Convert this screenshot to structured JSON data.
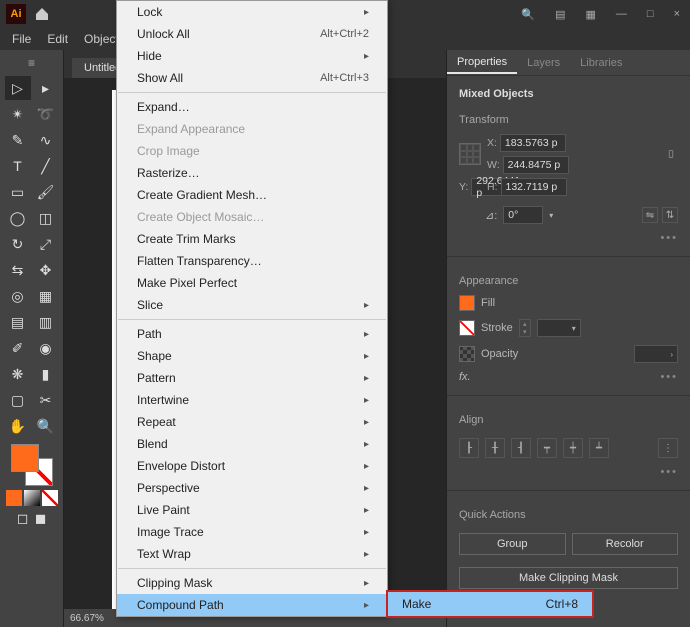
{
  "titlebar": {
    "search_icon": "🔍",
    "layout1": "▤",
    "layout2": "▦",
    "min": "—",
    "max": "□",
    "close": "×"
  },
  "menubar": {
    "file": "File",
    "edit": "Edit",
    "object": "Object"
  },
  "doc": {
    "tab": "Untitled",
    "zoom": "66.67%"
  },
  "menu": {
    "lock": "Lock",
    "unlock_all": "Unlock All",
    "unlock_all_sc": "Alt+Ctrl+2",
    "hide": "Hide",
    "show_all": "Show All",
    "show_all_sc": "Alt+Ctrl+3",
    "expand": "Expand…",
    "expand_appearance": "Expand Appearance",
    "crop_image": "Crop Image",
    "rasterize": "Rasterize…",
    "create_gradient_mesh": "Create Gradient Mesh…",
    "create_object_mosaic": "Create Object Mosaic…",
    "create_trim_marks": "Create Trim Marks",
    "flatten_transparency": "Flatten Transparency…",
    "make_pixel_perfect": "Make Pixel Perfect",
    "slice": "Slice",
    "path": "Path",
    "shape": "Shape",
    "pattern": "Pattern",
    "intertwine": "Intertwine",
    "repeat": "Repeat",
    "blend": "Blend",
    "envelope_distort": "Envelope Distort",
    "perspective": "Perspective",
    "live_paint": "Live Paint",
    "image_trace": "Image Trace",
    "text_wrap": "Text Wrap",
    "clipping_mask": "Clipping Mask",
    "compound_path": "Compound Path"
  },
  "submenu": {
    "make": "Make",
    "make_sc": "Ctrl+8"
  },
  "panel": {
    "tabs": {
      "properties": "Properties",
      "layers": "Layers",
      "libraries": "Libraries"
    },
    "selection": "Mixed Objects",
    "transform": {
      "title": "Transform",
      "x_label": "X:",
      "x_val": "183.5763 p",
      "y_label": "Y:",
      "y_val": "292.6441 p",
      "w_label": "W:",
      "w_val": "244.8475 p",
      "h_label": "H:",
      "h_val": "132.7119 p",
      "rot_label": "⊿:",
      "rot_val": "0°"
    },
    "appearance": {
      "title": "Appearance",
      "fill": "Fill",
      "stroke": "Stroke",
      "opacity": "Opacity",
      "fx": "fx."
    },
    "align": {
      "title": "Align"
    },
    "quick": {
      "title": "Quick Actions",
      "group": "Group",
      "recolor": "Recolor",
      "clipping": "Make Clipping Mask"
    }
  }
}
